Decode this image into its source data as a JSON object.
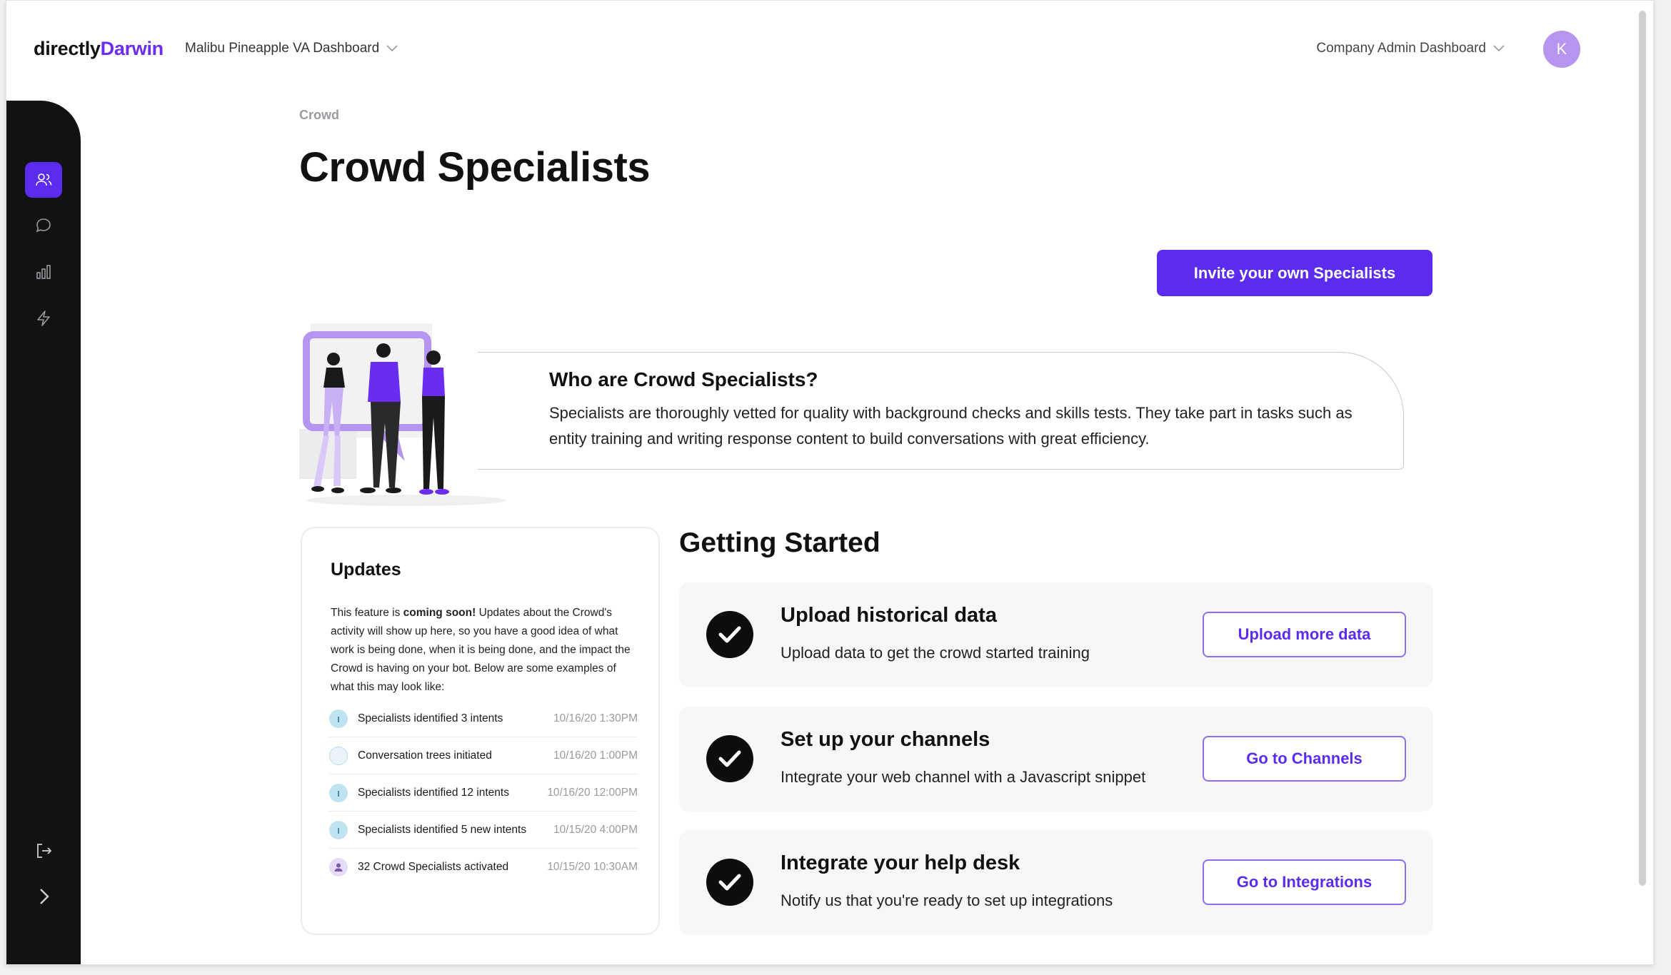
{
  "header": {
    "logo_prefix": "directly",
    "logo_suffix": "Darwin",
    "project_selector": "Malibu Pineapple VA Dashboard",
    "admin_selector": "Company Admin Dashboard",
    "avatar_initial": "K"
  },
  "sidebar": {
    "items": [
      {
        "icon": "users-icon",
        "active": true
      },
      {
        "icon": "chat-icon",
        "active": false
      },
      {
        "icon": "bar-chart-icon",
        "active": false
      },
      {
        "icon": "lightning-icon",
        "active": false
      }
    ],
    "bottom": [
      {
        "icon": "logout-icon"
      },
      {
        "icon": "chevron-right-icon"
      }
    ]
  },
  "page": {
    "breadcrumb": "Crowd",
    "title": "Crowd Specialists",
    "invite_button": "Invite your own Specialists"
  },
  "who": {
    "title": "Who are Crowd Specialists?",
    "text": "Specialists are thoroughly vetted for quality with background checks and skills tests. They take part in tasks such as entity training and writing response content to build conversations with great efficiency."
  },
  "updates": {
    "title": "Updates",
    "intro_before": "This feature is ",
    "intro_bold": "coming soon!",
    "intro_after": " Updates about the Crowd's activity will show up here, so you have a good idea of what work is being done, when it is being done, and the impact the Crowd is having on your bot. Below are some examples of what this may look like:",
    "items": [
      {
        "icon": "info-icon",
        "text": "Specialists identified 3 intents",
        "time": "10/16/20 1:30PM"
      },
      {
        "icon": "tree-icon",
        "text": "Conversation trees initiated",
        "time": "10/16/20 1:00PM"
      },
      {
        "icon": "info-icon",
        "text": "Specialists identified 12 intents",
        "time": "10/16/20 12:00PM"
      },
      {
        "icon": "info-icon",
        "text": "Specialists identified 5 new intents",
        "time": "10/15/20 4:00PM"
      },
      {
        "icon": "person-icon",
        "text": "32 Crowd Specialists activated",
        "time": "10/15/20 10:30AM"
      }
    ]
  },
  "getting_started": {
    "title": "Getting Started",
    "steps": [
      {
        "title": "Upload historical data",
        "subtitle": "Upload data to get the crowd started training",
        "button": "Upload more data"
      },
      {
        "title": "Set up your channels",
        "subtitle": "Integrate your web channel with a Javascript snippet",
        "button": "Go to Channels"
      },
      {
        "title": "Integrate your help desk",
        "subtitle": "Notify us that you're ready to set up integrations",
        "button": "Go to Integrations"
      }
    ]
  },
  "colors": {
    "accent": "#5b2cf0",
    "accent_light": "#b595f0",
    "sidebar": "#121212",
    "check": "#0d0d0d"
  }
}
